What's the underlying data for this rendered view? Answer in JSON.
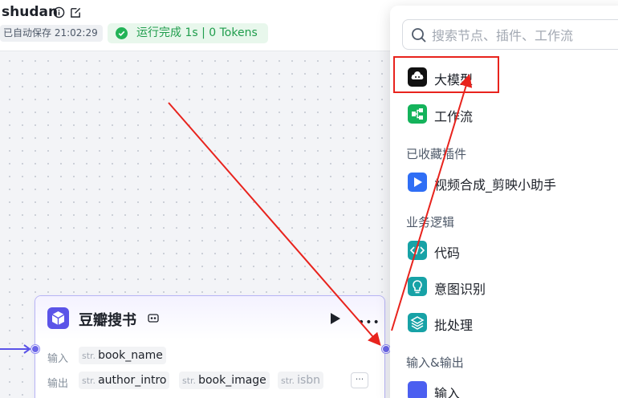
{
  "header": {
    "title": "shudan",
    "autosave_text": "已自动保存 21:02:29",
    "run_status_text": "运行完成 1s | 0 Tokens"
  },
  "node": {
    "title": "豆瓣搜书",
    "input_label": "输入",
    "output_label": "输出",
    "inputs": [
      {
        "type": "str.",
        "name": "book_name"
      }
    ],
    "outputs": [
      {
        "type": "str.",
        "name": "author_intro"
      },
      {
        "type": "str.",
        "name": "book_image"
      },
      {
        "type": "str.",
        "name": "isbn"
      }
    ],
    "more_outputs_label": "···"
  },
  "popup": {
    "search_placeholder": "搜索节点、插件、工作流",
    "top_items": [
      {
        "label": "大模型",
        "icon": "llm-icon",
        "color": "#111111"
      },
      {
        "label": "工作流",
        "icon": "workflow-icon",
        "color": "#14b35b"
      }
    ],
    "sections": [
      {
        "title": "已收藏插件",
        "items": [
          {
            "label": "视频合成_剪映小助手",
            "icon": "video-plugin-icon",
            "color": "#2f6ef5"
          }
        ]
      },
      {
        "title": "业务逻辑",
        "items": [
          {
            "label": "代码",
            "icon": "code-icon",
            "color": "#17a2a6"
          },
          {
            "label": "意图识别",
            "icon": "intent-icon",
            "color": "#17a2a6"
          },
          {
            "label": "批处理",
            "icon": "batch-icon",
            "color": "#17a2a6"
          }
        ]
      },
      {
        "title": "输入&输出",
        "items": [
          {
            "label": "输入",
            "icon": "input-icon",
            "color": "#4b5ff0"
          }
        ]
      }
    ]
  },
  "colors": {
    "accent": "#5b54e8",
    "success_text": "#1f9d4c",
    "success_bg": "#e8f7ec",
    "annotation": "#e8231d"
  }
}
